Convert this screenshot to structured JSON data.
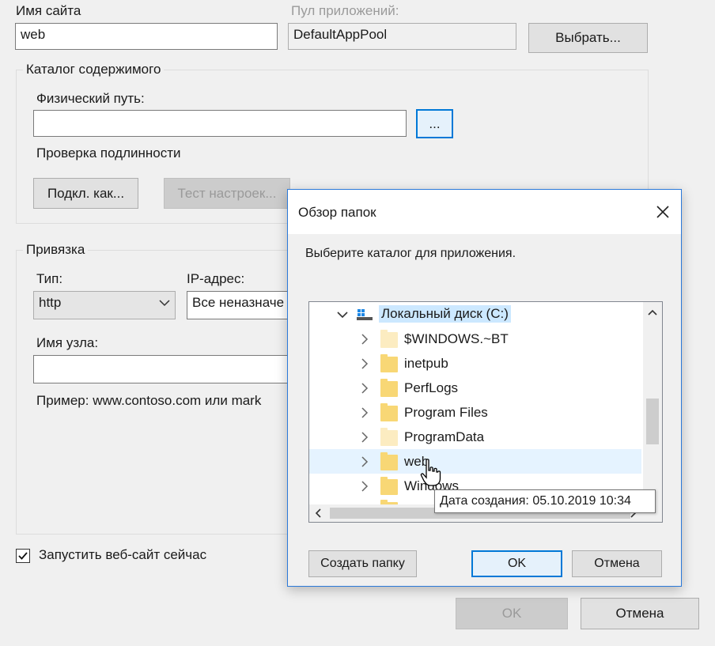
{
  "site": {
    "name_label": "Имя сайта",
    "name_value": "web",
    "pool_label": "Пул приложений:",
    "pool_value": "DefaultAppPool",
    "select_button": "Выбрать..."
  },
  "content_dir": {
    "title": "Каталог содержимого",
    "physical_path_label": "Физический путь:",
    "physical_path_value": "",
    "browse_button": "...",
    "auth_label": "Проверка подлинности",
    "connect_as_button": "Подкл. как...",
    "test_settings_button": "Тест настроек..."
  },
  "binding": {
    "title": "Привязка",
    "type_label": "Тип:",
    "type_value": "http",
    "ip_label": "IP-адрес:",
    "ip_value": "Все неназначе",
    "host_label": "Имя узла:",
    "host_value": "",
    "example": "Пример: www.contoso.com или mark"
  },
  "start_now": {
    "label": "Запустить веб-сайт сейчас",
    "checked": true
  },
  "footer": {
    "ok": "OK",
    "cancel": "Отмена"
  },
  "browse_dialog": {
    "title": "Обзор папок",
    "instruction": "Выберите каталог для приложения.",
    "tree": {
      "root": "Локальный диск (C:)",
      "items": [
        "$WINDOWS.~BT",
        "inetpub",
        "PerfLogs",
        "Program Files",
        "ProgramData",
        "web",
        "Windows"
      ]
    },
    "tooltip": "Дата создания: 05.10.2019 10:34",
    "new_folder_button": "Создать папку",
    "ok_button": "OK",
    "cancel_button": "Отмена"
  },
  "colors": {
    "accent": "#0078d7",
    "folder": "#f8d775",
    "selection": "#cce8ff"
  }
}
